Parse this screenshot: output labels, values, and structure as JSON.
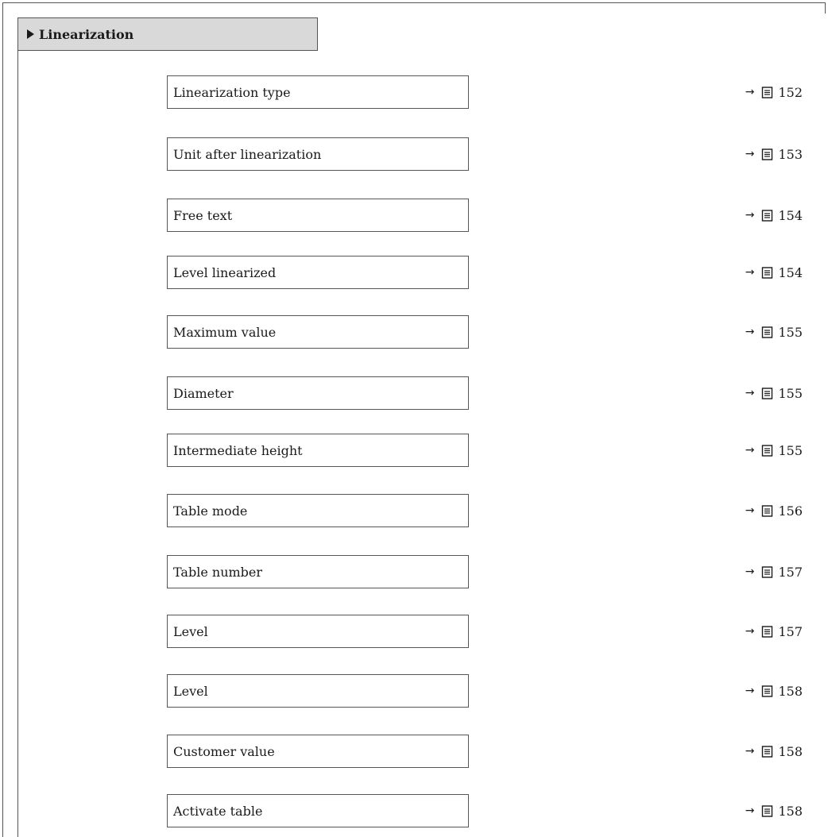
{
  "menu": {
    "title": "Linearization"
  },
  "params": [
    {
      "label": "Linearization type",
      "arrow": "→",
      "page": "152"
    },
    {
      "label": "Unit after linearization",
      "arrow": "→",
      "page": "153"
    },
    {
      "label": "Free text",
      "arrow": "→",
      "page": "154"
    },
    {
      "label": "Level linearized",
      "arrow": "→",
      "page": "154"
    },
    {
      "label": "Maximum value",
      "arrow": "→",
      "page": "155"
    },
    {
      "label": "Diameter",
      "arrow": "→",
      "page": "155"
    },
    {
      "label": "Intermediate height",
      "arrow": "→",
      "page": "155"
    },
    {
      "label": "Table mode",
      "arrow": "→",
      "page": "156"
    },
    {
      "label": "Table number",
      "arrow": "→",
      "page": "157"
    },
    {
      "label": "Level",
      "arrow": "→",
      "page": "157"
    },
    {
      "label": "Level",
      "arrow": "→",
      "page": "158"
    },
    {
      "label": "Customer value",
      "arrow": "→",
      "page": "158"
    },
    {
      "label": "Activate table",
      "arrow": "→",
      "page": "158"
    }
  ],
  "icons": {
    "header_marker": "triangle-right-icon",
    "page_ref_arrow": "arrow-right-icon",
    "page_ref_book": "book-page-icon"
  },
  "colors": {
    "header_background": "#d9d9d9",
    "border": "#555555",
    "text": "#1a1a1a"
  }
}
